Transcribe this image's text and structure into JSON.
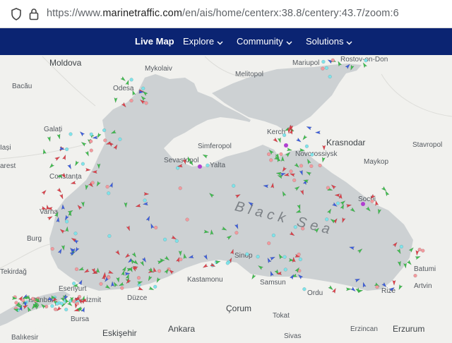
{
  "browser": {
    "url_prefix": "https://www.",
    "url_domain": "marinetraffic.com",
    "url_path": "/en/ais/home/centerx:38.8/centery:43.7/zoom:6"
  },
  "nav": {
    "live_map": "Live Map",
    "explore": "Explore",
    "community": "Community",
    "solutions": "Solutions"
  },
  "map": {
    "sea_label": "Black Sea",
    "places": {
      "moldova": "Moldova",
      "mykolaiv": "Mykolaiv",
      "melitopol": "Melitopol",
      "mariupol": "Mariupol",
      "rostov": "Rostov-on-Don",
      "bacau": "Bacău",
      "odesa": "Odesa",
      "galati": "Galați",
      "iasi": "Iași",
      "bucharest": "arest",
      "simferopol": "Simferopol",
      "sevastopol": "Sevastopol",
      "yalta": "Yalta",
      "kerch": "Kerch",
      "novorossiysk": "Novorossiysk",
      "krasnodar": "Krasnodar",
      "stavropol": "Stavropol",
      "maykop": "Maykop",
      "sochi": "Sochi",
      "constanta": "Constanța",
      "varna": "Varna",
      "burgas": "Burg",
      "tekirdag": "Tekirdağ",
      "istanbul": "İstanbul",
      "esenyurt": "Esenyurt",
      "izmit": "İzmit",
      "duzce": "Düzce",
      "kastamonu": "Kastamonu",
      "sinop": "Sinop",
      "samsun": "Samsun",
      "ordu": "Ordu",
      "rize": "Rize",
      "batumi": "Batumi",
      "artvin": "Artvin",
      "bursa": "Bursa",
      "corum": "Çorum",
      "tokat": "Tokat",
      "eskisehir": "Eskişehir",
      "ankara": "Ankara",
      "sivas": "Sivas",
      "erzincan": "Erzincan",
      "erzurum": "Erzurum",
      "balikesir": "Balıkesir"
    },
    "colors": {
      "sea": "#cdd1d3",
      "land": "#f1f1ee",
      "tanker": "#e0404a",
      "cargo": "#3fbf4f",
      "passenger": "#3c5ee0",
      "station": "#7fe3ea",
      "pleasure": "#b03fd0",
      "other": "#f29a9e"
    }
  }
}
